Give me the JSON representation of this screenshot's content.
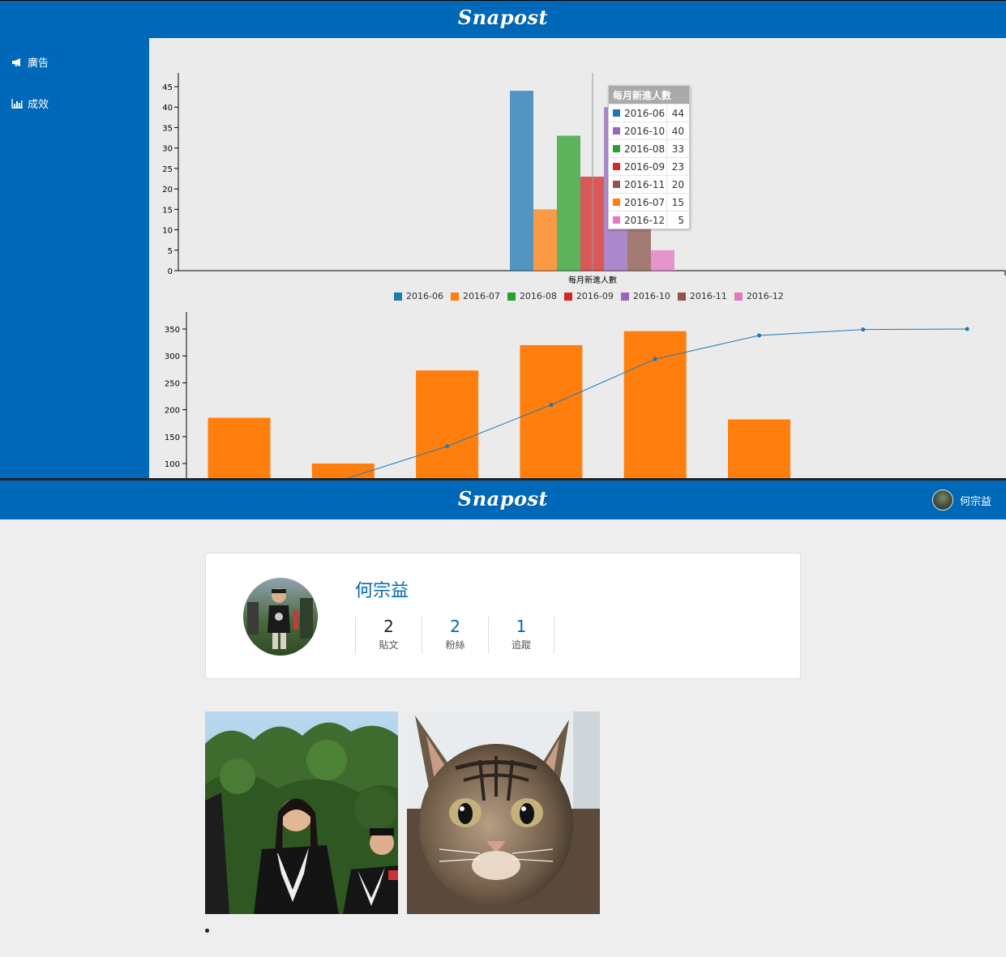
{
  "app": {
    "brand": "Snapost",
    "user_name": "何宗益"
  },
  "sidebar": {
    "items": [
      {
        "label": "廣告",
        "icon": "bullhorn-icon"
      },
      {
        "label": "成效",
        "icon": "bar-chart-icon"
      }
    ]
  },
  "colors": {
    "nav": "#0068b8",
    "accent_orange": "#ff7f0e"
  },
  "chart_data": [
    {
      "type": "bar",
      "xlabel": "每月新進人數",
      "ylim": [
        0,
        48
      ],
      "yticks": [
        0,
        5,
        10,
        15,
        20,
        25,
        30,
        35,
        40,
        45
      ],
      "series": [
        {
          "name": "2016-06",
          "value": 44,
          "color": "#1f77b4"
        },
        {
          "name": "2016-07",
          "value": 15,
          "color": "#ff7f0e"
        },
        {
          "name": "2016-08",
          "value": 33,
          "color": "#2ca02c"
        },
        {
          "name": "2016-09",
          "value": 23,
          "color": "#d62728"
        },
        {
          "name": "2016-10",
          "value": 40,
          "color": "#9467bd"
        },
        {
          "name": "2016-11",
          "value": 20,
          "color": "#8c564b"
        },
        {
          "name": "2016-12",
          "value": 5,
          "color": "#e377c2"
        }
      ],
      "legend_placement": "bottom",
      "tooltip": {
        "title": "每月新進人數",
        "rows": [
          {
            "name": "2016-06",
            "value": "44",
            "color": "#1f77b4"
          },
          {
            "name": "2016-10",
            "value": "40",
            "color": "#9467bd"
          },
          {
            "name": "2016-08",
            "value": "33",
            "color": "#2ca02c"
          },
          {
            "name": "2016-09",
            "value": "23",
            "color": "#d62728"
          },
          {
            "name": "2016-11",
            "value": "20",
            "color": "#8c564b"
          },
          {
            "name": "2016-07",
            "value": "15",
            "color": "#ff7f0e"
          },
          {
            "name": "2016-12",
            "value": "5",
            "color": "#e377c2"
          }
        ]
      }
    },
    {
      "type": "bar",
      "yticks": [
        100,
        150,
        200,
        250,
        300,
        350
      ],
      "ylim": [
        75,
        375
      ],
      "bars": [
        185,
        100,
        273,
        320,
        346,
        182,
        null,
        null
      ],
      "bar_color": "#ff7f0e",
      "line": [
        null,
        70,
        132,
        209,
        294,
        338,
        349,
        350
      ],
      "line_color": "#1f77b4"
    }
  ],
  "profile": {
    "name": "何宗益",
    "stats": [
      {
        "value": "2",
        "label": "貼文",
        "highlight": false
      },
      {
        "value": "2",
        "label": "粉絲",
        "highlight": true
      },
      {
        "value": "1",
        "label": "追蹤",
        "highlight": true
      }
    ]
  }
}
